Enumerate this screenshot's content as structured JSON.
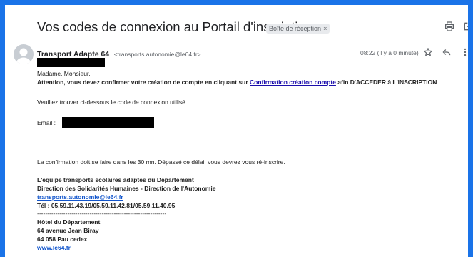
{
  "email": {
    "subject": "Vos codes de connexion au Portail d'inscription",
    "label": "Boîte de réception",
    "label_close": "×",
    "sender_name": "Transport Adapte 64",
    "sender_email": "<transports.autonomie@le64.fr>",
    "time": "08:22 (il y a 0 minute)"
  },
  "body": {
    "greeting": "Madame, Monsieur,",
    "attention_prefix": "Attention, vous devez confirmer votre création de compte en cliquant sur ",
    "attention_link": "Confirmation création compte",
    "attention_suffix": " afin D'ACCEDER à L'INSCRIPTION",
    "code_intro": "Veuillez trouver ci-dessous le code de connexion utilisé :",
    "email_label": "Email :",
    "confirmation_note": "La confirmation doit se faire dans les 30 mn. Dépassé ce délai, vous devrez vous ré-inscrire.",
    "team_line": "L'équipe transports scolaires adaptés du Département",
    "direction_line": "Direction des Solidarités Humaines - Direction de l'Autonomie",
    "contact_email": "transports.autonomie@le64.fr",
    "phone_line": "Tél : 05.59.11.43.19/05.59.11.42.81/05.59.11.40.95",
    "separator": "----------------------------------------------------------------",
    "address_1": "Hôtel du Département",
    "address_2": "64 avenue Jean Biray",
    "address_3": "64 058 Pau cedex",
    "website": "www.le64.fr"
  },
  "icons": {
    "print": "print-icon",
    "open_new": "open-in-new-window-icon",
    "star": "star-icon",
    "reply": "reply-icon",
    "more": "more-vertical-icon"
  }
}
